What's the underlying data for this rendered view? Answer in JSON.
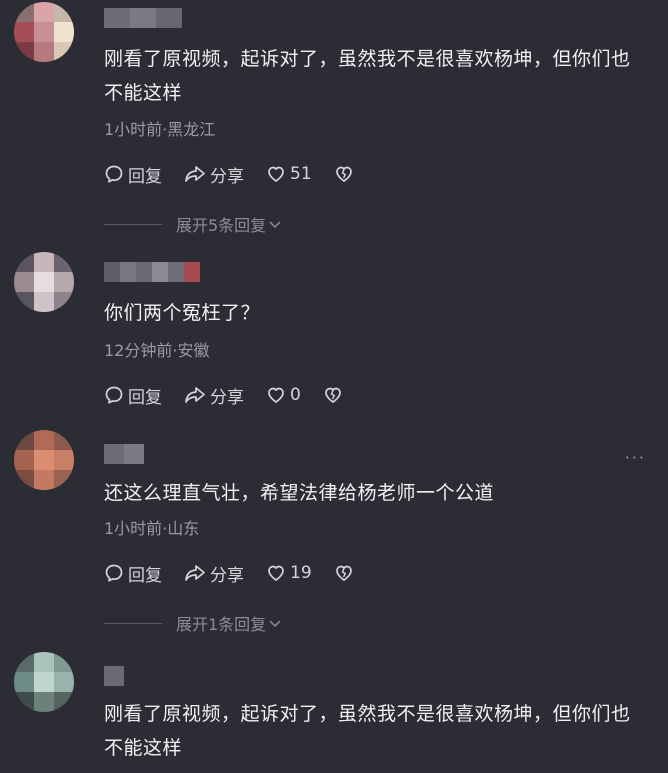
{
  "comments": [
    {
      "text": "刚看了原视频，起诉对了，虽然我不是很喜欢杨坤，但你们也不能这样",
      "meta": "1小时前·黑龙江",
      "reply_label": "回复",
      "share_label": "分享",
      "like_count": "51",
      "expand_label": "展开5条回复"
    },
    {
      "text": "你们两个冤枉了？",
      "meta": "12分钟前·安徽",
      "reply_label": "回复",
      "share_label": "分享",
      "like_count": "0"
    },
    {
      "text": "还这么理直气壮，希望法律给杨老师一个公道",
      "meta": "1小时前·山东",
      "reply_label": "回复",
      "share_label": "分享",
      "like_count": "19",
      "expand_label": "展开1条回复",
      "more_label": "···"
    },
    {
      "text": "刚看了原视频，起诉对了，虽然我不是很喜欢杨坤，但你们也不能这样"
    }
  ]
}
